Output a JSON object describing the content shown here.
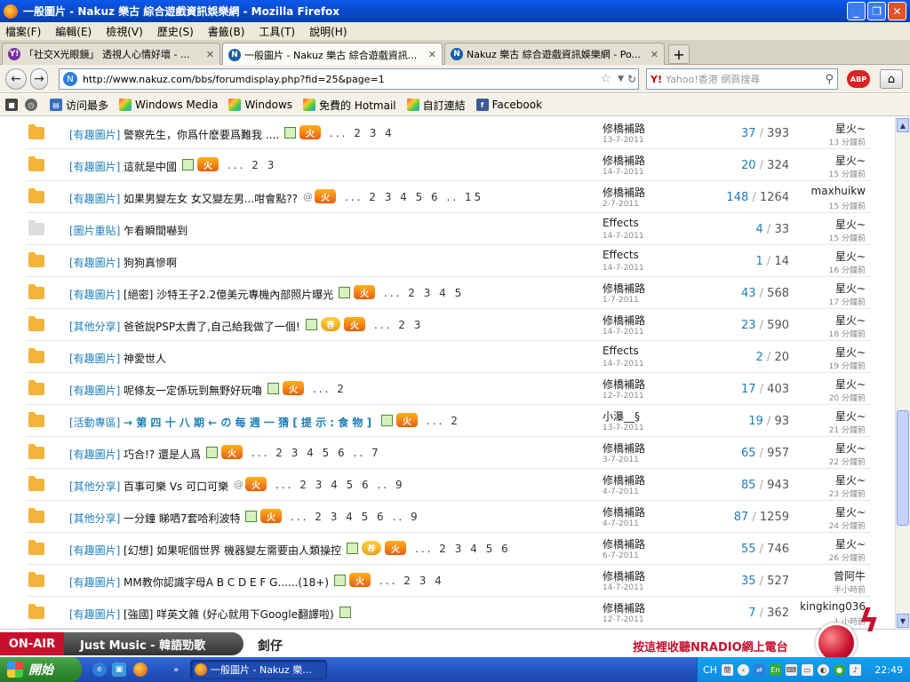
{
  "window": {
    "title": "一般圖片 - Nakuz 樂古 綜合遊戲資訊娛樂網 - Mozilla Firefox"
  },
  "menu": [
    "檔案(F)",
    "編輯(E)",
    "檢視(V)",
    "歷史(S)",
    "書籤(B)",
    "工具(T)",
    "說明(H)"
  ],
  "tabs": [
    {
      "label": "「社交X光眼鏡」 透視人心情好壞 - ...",
      "icon": "yahoo-icon"
    },
    {
      "label": "一般圖片 - Nakuz 樂古 綜合遊戲資訊...",
      "icon": "nakuz-icon",
      "active": true
    },
    {
      "label": "Nakuz 樂古 綜合遊戲資訊娛樂網 - Po...",
      "icon": "nakuz-icon"
    }
  ],
  "nav": {
    "url": "http://www.nakuz.com/bbs/forumdisplay.php?fid=25&page=1",
    "search_placeholder": "Yahoo!香港 網頁搜尋",
    "search_engine_label": "Y!",
    "abp_label": "ABP"
  },
  "bookmarks": [
    "访问最多",
    "Windows Media",
    "Windows",
    "免費的 Hotmail",
    "自訂連結",
    "Facebook"
  ],
  "threads": [
    {
      "cat": "[有趣圖片]",
      "title": "警察先生，你爲什麽要爲難我 ....",
      "tags": [
        "img",
        "hot"
      ],
      "pages": "... 2 3 4",
      "author": "修橋補路",
      "date": "13-7-2011",
      "replies": "37",
      "views": "393",
      "last": "星火~",
      "ago": "13 分鐘前"
    },
    {
      "cat": "[有趣圖片]",
      "title": "這就是中國",
      "tags": [
        "img",
        "hot"
      ],
      "pages": "... 2 3",
      "author": "修橋補路",
      "date": "14-7-2011",
      "replies": "20",
      "views": "324",
      "last": "星火~",
      "ago": "15 分鐘前"
    },
    {
      "cat": "[有趣圖片]",
      "title": "如果男變左女 女又變左男...咁會點??",
      "tags": [
        "att",
        "hot"
      ],
      "pages": "... 2 3 4 5 6 .. 15",
      "author": "修橋補路",
      "date": "2-7-2011",
      "replies": "148",
      "views": "1264",
      "last": "maxhuikw",
      "ago": "15 分鐘前"
    },
    {
      "cat": "[圖片重貼]",
      "title": "乍看瞬間嚇到",
      "tags": [],
      "pages": "",
      "author": "Effects",
      "date": "14-7-2011",
      "replies": "4",
      "views": "33",
      "last": "星火~",
      "ago": "15 分鐘前",
      "gray": true
    },
    {
      "cat": "[有趣圖片]",
      "title": "狗狗真慘啊",
      "tags": [],
      "pages": "",
      "author": "Effects",
      "date": "14-7-2011",
      "replies": "1",
      "views": "14",
      "last": "星火~",
      "ago": "16 分鐘前"
    },
    {
      "cat": "[有趣圖片]",
      "title": "[絕密] 沙特王子2.2億美元專機內部照片曝光",
      "tags": [
        "img",
        "hot"
      ],
      "pages": "... 2 3 4 5",
      "author": "修橋補路",
      "date": "1-7-2011",
      "replies": "43",
      "views": "568",
      "last": "星火~",
      "ago": "17 分鐘前"
    },
    {
      "cat": "[其他分享]",
      "title": "爸爸說PSP太貴了,自己給我做了一個!",
      "tags": [
        "img",
        "rec",
        "hot"
      ],
      "pages": "... 2 3",
      "author": "修橋補路",
      "date": "14-7-2011",
      "replies": "23",
      "views": "590",
      "last": "星火~",
      "ago": "18 分鐘前"
    },
    {
      "cat": "[有趣圖片]",
      "title": "神愛世人",
      "tags": [],
      "pages": "",
      "author": "Effects",
      "date": "14-7-2011",
      "replies": "2",
      "views": "20",
      "last": "星火~",
      "ago": "19 分鐘前"
    },
    {
      "cat": "[有趣圖片]",
      "title": "呢條友一定係玩到無野好玩嚕",
      "tags": [
        "img",
        "hot"
      ],
      "pages": "... 2",
      "author": "修橋補路",
      "date": "12-7-2011",
      "replies": "17",
      "views": "403",
      "last": "星火~",
      "ago": "20 分鐘前"
    },
    {
      "cat": "[活動專區]",
      "title": "→ 第 四 十 八 期 ← の 每 週 一 猜 [ 提 示 : 食 物 ]",
      "tags": [
        "img",
        "hot"
      ],
      "pages": "... 2",
      "author": "小瀑__§",
      "date": "13-7-2011",
      "replies": "19",
      "views": "93",
      "last": "星火~",
      "ago": "21 分鐘前",
      "special": true
    },
    {
      "cat": "[有趣圖片]",
      "title": "巧合!? 還是人爲",
      "tags": [
        "img",
        "hot"
      ],
      "pages": "... 2 3 4 5 6 .. 7",
      "author": "修橋補路",
      "date": "3-7-2011",
      "replies": "65",
      "views": "957",
      "last": "星火~",
      "ago": "22 分鐘前"
    },
    {
      "cat": "[其他分享]",
      "title": "百事可樂 Vs 可口可樂",
      "tags": [
        "att",
        "hot"
      ],
      "pages": "... 2 3 4 5 6 .. 9",
      "author": "修橋補路",
      "date": "4-7-2011",
      "replies": "85",
      "views": "943",
      "last": "星火~",
      "ago": "23 分鐘前"
    },
    {
      "cat": "[其他分享]",
      "title": "一分鐘 睇哂7套哈利波特",
      "tags": [
        "img",
        "hot"
      ],
      "pages": "... 2 3 4 5 6 .. 9",
      "author": "修橋補路",
      "date": "4-7-2011",
      "replies": "87",
      "views": "1259",
      "last": "星火~",
      "ago": "24 分鐘前"
    },
    {
      "cat": "[有趣圖片]",
      "title": "[幻想] 如果呢個世界 機器變左需要由人類操控",
      "tags": [
        "img",
        "rec",
        "hot"
      ],
      "pages": "... 2 3 4 5 6",
      "author": "修橋補路",
      "date": "6-7-2011",
      "replies": "55",
      "views": "746",
      "last": "星火~",
      "ago": "26 分鐘前"
    },
    {
      "cat": "[有趣圖片]",
      "title": "MM教你認識字母A B C D E F G......(18+)",
      "tags": [
        "img",
        "hot"
      ],
      "pages": "... 2 3 4",
      "author": "修橋補路",
      "date": "14-7-2011",
      "replies": "35",
      "views": "527",
      "last": "曾阿牛",
      "ago": "半小時前"
    },
    {
      "cat": "[有趣圖片]",
      "title": "[強國] 咩英文雜 (好心就用下Google翻譯啦)",
      "tags": [
        "img"
      ],
      "pages": "",
      "author": "修橋補路",
      "date": "12-7-2011",
      "replies": "7",
      "views": "362",
      "last": "kingking036",
      "ago": "1 小時前"
    }
  ],
  "tag_labels": {
    "hot": "火",
    "rec": "荐",
    "att": "@"
  },
  "radio": {
    "onair": "ON-AIR",
    "channel": "Just Music - 韓語勁歌",
    "song": "釗仔",
    "promo": "按這裡收聽NRADIO網上電台"
  },
  "taskbar": {
    "start": "開始",
    "item": "一般圖片 - Nakuz 樂...",
    "lang": "CH",
    "clock": "22:49",
    "en": "En"
  },
  "colors": {
    "accent": "#1b7fb5",
    "folder": "#f5b33a",
    "radio_red": "#c8102e"
  }
}
